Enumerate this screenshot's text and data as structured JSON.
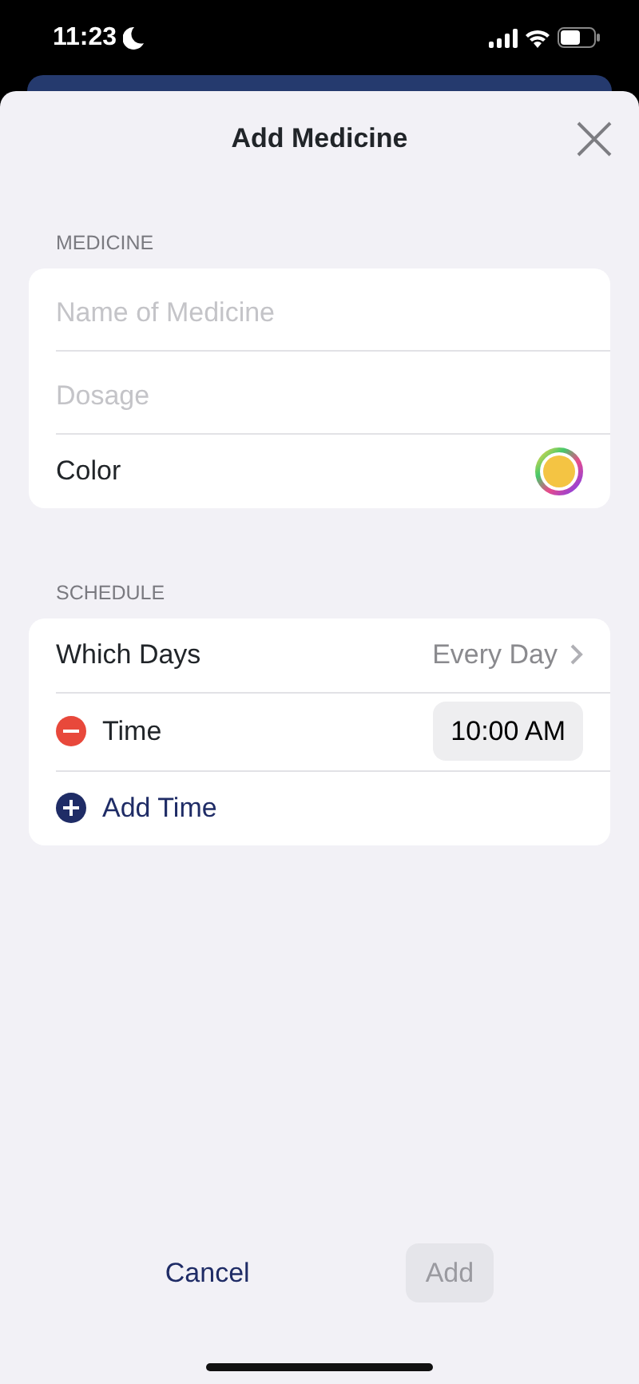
{
  "status_bar": {
    "time": "11:23",
    "do_not_disturb": true
  },
  "sheet": {
    "title": "Add Medicine"
  },
  "sections": [
    {
      "header": "MEDICINE",
      "rows": [
        {
          "kind": "field",
          "placeholder": "Name of Medicine"
        },
        {
          "kind": "field",
          "placeholder": "Dosage"
        },
        {
          "kind": "color",
          "label": "Color",
          "color": "#f4c443"
        }
      ]
    },
    {
      "header": "SCHEDULE",
      "rows": [
        {
          "kind": "link",
          "label": "Which Days",
          "value": "Every Day"
        },
        {
          "kind": "time",
          "label": "Time",
          "value": "10:00 AM"
        },
        {
          "kind": "add",
          "label": "Add Time"
        }
      ]
    }
  ],
  "actions": [
    {
      "label": "Cancel",
      "disabled": false,
      "kind": "plain"
    },
    {
      "label": "Add",
      "disabled": true,
      "kind": "filled"
    }
  ]
}
